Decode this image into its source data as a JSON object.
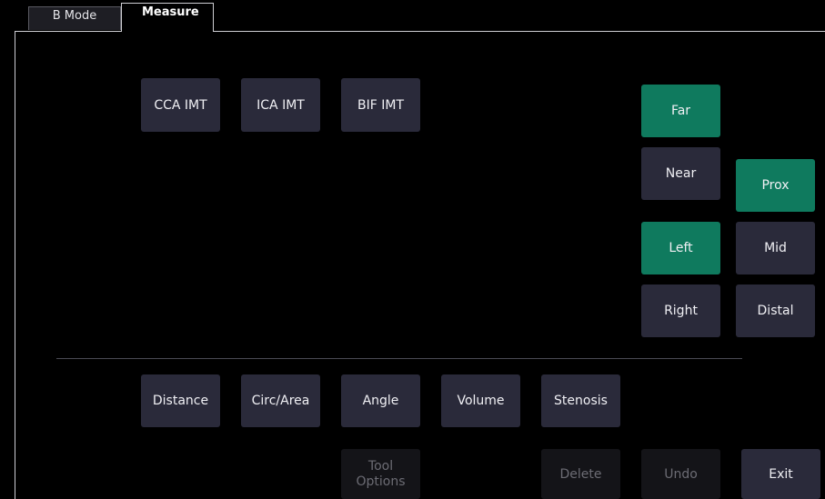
{
  "tabs": [
    {
      "label": "B Mode",
      "active": false
    },
    {
      "label": "Measure",
      "active": true
    }
  ],
  "imt_buttons": [
    "CCA IMT",
    "ICA IMT",
    "BIF IMT"
  ],
  "wall": {
    "far": "Far",
    "near": "Near",
    "selected": "Far"
  },
  "side": {
    "left": "Left",
    "right": "Right",
    "selected": "Left"
  },
  "segment": {
    "prox": "Prox",
    "mid": "Mid",
    "distal": "Distal",
    "selected": "Prox"
  },
  "tools": [
    "Distance",
    "Circ/Area",
    "Angle",
    "Volume",
    "Stenosis"
  ],
  "bottom": {
    "tool_options": "Tool Options",
    "delete": "Delete",
    "undo": "Undo",
    "exit": "Exit"
  },
  "colors": {
    "background": "#000000",
    "button": "#2a2a3a",
    "active_button": "#0f7a5e",
    "disabled_button": "#141418"
  }
}
